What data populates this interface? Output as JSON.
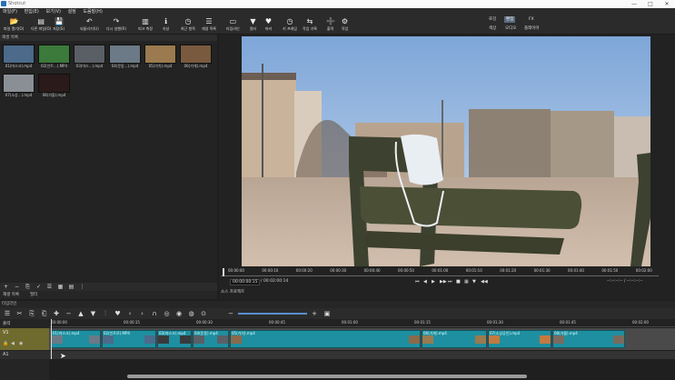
{
  "window": {
    "title": "Shotcut",
    "minimize": "—",
    "maximize": "□",
    "close": "✕"
  },
  "menu": [
    "파일(F)",
    "편집(E)",
    "보기(V)",
    "설정",
    "도움말(H)"
  ],
  "toolbar": [
    {
      "icon": "folder-open-icon",
      "glyph": "📂",
      "label": "파일 열기(O)"
    },
    {
      "icon": "file-other-icon",
      "glyph": "▤",
      "label": "다른 파일(O)"
    },
    {
      "icon": "save-icon",
      "glyph": "💾",
      "label": "저장(S)"
    },
    {
      "icon": "undo-icon",
      "glyph": "↶",
      "label": "되돌리기(U)"
    },
    {
      "icon": "redo-icon",
      "glyph": "↷",
      "label": "다시 실행(R)"
    },
    {
      "icon": "peak-meter-icon",
      "glyph": "▥",
      "label": "피크 측정"
    },
    {
      "icon": "properties-icon",
      "glyph": "ℹ",
      "label": "속성"
    },
    {
      "icon": "recent-icon",
      "glyph": "◷",
      "label": "최근 항목"
    },
    {
      "icon": "playlist-icon",
      "glyph": "☰",
      "label": "재생 목록"
    },
    {
      "icon": "timeline-icon",
      "glyph": "▭",
      "label": "타임라인"
    },
    {
      "icon": "filter-icon",
      "glyph": "▼",
      "label": "필터"
    },
    {
      "icon": "markers-icon",
      "glyph": "♥",
      "label": "마커"
    },
    {
      "icon": "keyframes-icon",
      "glyph": "◷",
      "label": "키 프레임"
    },
    {
      "icon": "history-icon",
      "glyph": "⇆",
      "label": "작업 기록"
    },
    {
      "icon": "export-icon",
      "glyph": "➕",
      "label": "출력"
    },
    {
      "icon": "jobs-icon",
      "glyph": "⚙",
      "label": "작업"
    }
  ],
  "layouts": {
    "row1": [
      {
        "label": "로깅",
        "selected": false
      },
      {
        "label": "편집",
        "selected": true
      },
      {
        "label": "FX",
        "selected": false
      }
    ],
    "row2": [
      {
        "label": "색상",
        "selected": false
      },
      {
        "label": "오디오",
        "selected": false
      },
      {
        "label": "플레이어",
        "selected": false
      }
    ]
  },
  "playlist": {
    "title": "재생 목록",
    "items": [
      {
        "label": "01(마스크).mp4"
      },
      {
        "label": "02(인트...).MP4"
      },
      {
        "label": "03(마스...).mp4"
      },
      {
        "label": "04(운동...).mp4"
      },
      {
        "label": "05(가치).mp4"
      },
      {
        "label": "06(가게).mp4"
      },
      {
        "label": "07(소상...).mp4"
      },
      {
        "label": "08(가을).mp4"
      }
    ],
    "tabs": [
      "재생 목록",
      "필터"
    ],
    "buttons": [
      "+",
      "−",
      "⎘",
      "✓",
      "☰",
      "▦",
      "▤",
      "⋮"
    ]
  },
  "viewer": {
    "scrub_labels": [
      "00:00:00",
      "00:00:10",
      "00:00:20",
      "00:00:30",
      "00:00:40",
      "00:00:50",
      "00:01:00",
      "00:01:10",
      "00:01:20",
      "00:01:30",
      "00:01:40",
      "00:01:50",
      "00:02:00"
    ],
    "position": "00:00:00:15",
    "duration": "/ 00:02:00:14",
    "in_out": "--:--:--:-- / --:--:--:--",
    "tabs": "소스   프로젝트",
    "controls": [
      "⏮",
      "◀",
      "▶",
      "▶▶",
      "⏭",
      "■",
      "▦",
      "▼",
      "◀◀"
    ]
  },
  "timeline": {
    "header": "타임라인",
    "output_label": "출력",
    "ruler": [
      "00:00:00",
      "00:00:15",
      "00:00:30",
      "00:00:45",
      "00:01:00",
      "00:01:15",
      "00:01:30",
      "00:01:45",
      "00:02:00"
    ],
    "v1_label": "V1",
    "a1_label": "A1",
    "clips": [
      {
        "label": "01(마스크).mp4",
        "w": 55
      },
      {
        "label": "02(인트로).MP4",
        "w": 60
      },
      {
        "label": "03(마스크).mp4",
        "w": 38
      },
      {
        "label": "04(운동).mp4",
        "w": 40
      },
      {
        "label": "05(가치).mp4",
        "w": 210
      },
      {
        "label": "06(가게).mp4",
        "w": 72
      },
      {
        "label": "07(소상공인).mp4",
        "w": 70
      },
      {
        "label": "08(가을).mp4",
        "w": 80
      }
    ]
  }
}
